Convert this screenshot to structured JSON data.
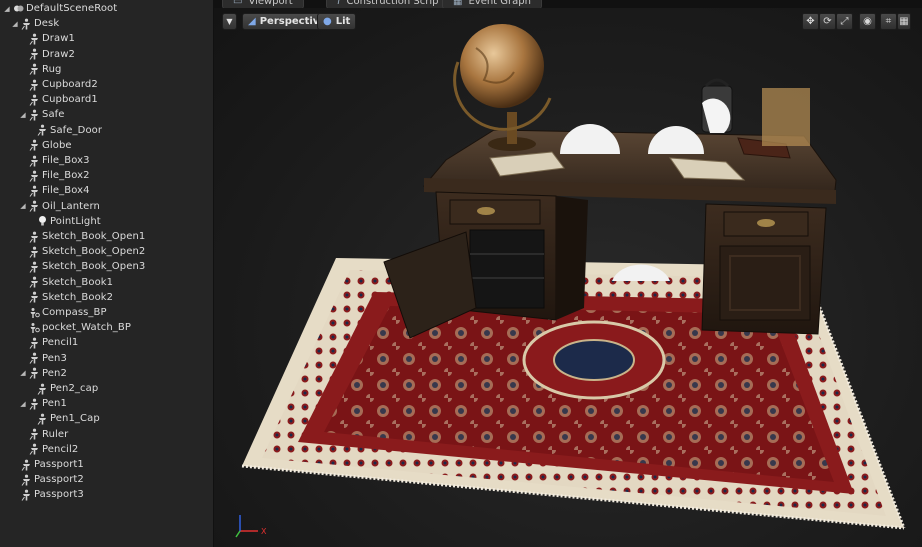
{
  "tabs": [
    {
      "label": "Viewport",
      "icon": "viewport-icon"
    },
    {
      "label": "Construction Scrip",
      "icon": "function-icon"
    },
    {
      "label": "Event Graph",
      "icon": "graph-icon"
    }
  ],
  "viewport": {
    "view_mode_label": "Perspective",
    "lighting_label": "Lit"
  },
  "outliner": {
    "items": [
      {
        "label": "DefaultSceneRoot",
        "indent": 0,
        "icon": "scene-root-icon",
        "expander": "expanded"
      },
      {
        "label": "Desk",
        "indent": 1,
        "icon": "static-mesh-icon",
        "expander": "expanded"
      },
      {
        "label": "Draw1",
        "indent": 2,
        "icon": "static-mesh-icon",
        "expander": "none"
      },
      {
        "label": "Draw2",
        "indent": 2,
        "icon": "static-mesh-icon",
        "expander": "none"
      },
      {
        "label": "Rug",
        "indent": 2,
        "icon": "static-mesh-icon",
        "expander": "none"
      },
      {
        "label": "Cupboard2",
        "indent": 2,
        "icon": "static-mesh-icon",
        "expander": "none"
      },
      {
        "label": "Cupboard1",
        "indent": 2,
        "icon": "static-mesh-icon",
        "expander": "none"
      },
      {
        "label": "Safe",
        "indent": 2,
        "icon": "static-mesh-icon",
        "expander": "expanded"
      },
      {
        "label": "Safe_Door",
        "indent": 3,
        "icon": "static-mesh-icon",
        "expander": "none"
      },
      {
        "label": "Globe",
        "indent": 2,
        "icon": "static-mesh-icon",
        "expander": "none"
      },
      {
        "label": "File_Box3",
        "indent": 2,
        "icon": "static-mesh-icon",
        "expander": "none"
      },
      {
        "label": "File_Box2",
        "indent": 2,
        "icon": "static-mesh-icon",
        "expander": "none"
      },
      {
        "label": "File_Box4",
        "indent": 2,
        "icon": "static-mesh-icon",
        "expander": "none"
      },
      {
        "label": "Oil_Lantern",
        "indent": 2,
        "icon": "static-mesh-icon",
        "expander": "expanded"
      },
      {
        "label": "PointLight",
        "indent": 3,
        "icon": "point-light-icon",
        "expander": "none"
      },
      {
        "label": "Sketch_Book_Open1",
        "indent": 2,
        "icon": "static-mesh-icon",
        "expander": "none"
      },
      {
        "label": "Sketch_Book_Open2",
        "indent": 2,
        "icon": "static-mesh-icon",
        "expander": "none"
      },
      {
        "label": "Sketch_Book_Open3",
        "indent": 2,
        "icon": "static-mesh-icon",
        "expander": "none"
      },
      {
        "label": "Sketch_Book1",
        "indent": 2,
        "icon": "static-mesh-icon",
        "expander": "none"
      },
      {
        "label": "Sketch_Book2",
        "indent": 2,
        "icon": "static-mesh-icon",
        "expander": "none"
      },
      {
        "label": "Compass_BP",
        "indent": 2,
        "icon": "child-actor-icon",
        "expander": "none"
      },
      {
        "label": "pocket_Watch_BP",
        "indent": 2,
        "icon": "child-actor-icon",
        "expander": "none"
      },
      {
        "label": "Pencil1",
        "indent": 2,
        "icon": "static-mesh-icon",
        "expander": "none"
      },
      {
        "label": "Pen3",
        "indent": 2,
        "icon": "static-mesh-icon",
        "expander": "none"
      },
      {
        "label": "Pen2",
        "indent": 2,
        "icon": "static-mesh-icon",
        "expander": "expanded"
      },
      {
        "label": "Pen2_cap",
        "indent": 3,
        "icon": "static-mesh-icon",
        "expander": "none"
      },
      {
        "label": "Pen1",
        "indent": 2,
        "icon": "static-mesh-icon",
        "expander": "expanded"
      },
      {
        "label": "Pen1_Cap",
        "indent": 3,
        "icon": "static-mesh-icon",
        "expander": "none"
      },
      {
        "label": "Ruler",
        "indent": 2,
        "icon": "static-mesh-icon",
        "expander": "none"
      },
      {
        "label": "Pencil2",
        "indent": 2,
        "icon": "static-mesh-icon",
        "expander": "none"
      },
      {
        "label": "Passport1",
        "indent": 1,
        "icon": "static-mesh-icon",
        "expander": "none"
      },
      {
        "label": "Passport2",
        "indent": 1,
        "icon": "static-mesh-icon",
        "expander": "none"
      },
      {
        "label": "Passport3",
        "indent": 1,
        "icon": "static-mesh-icon",
        "expander": "none"
      }
    ]
  },
  "toolbar_right": [
    {
      "icon": "translate-icon"
    },
    {
      "icon": "rotate-icon"
    },
    {
      "icon": "scale-icon"
    },
    {
      "icon": "world-space-icon"
    },
    {
      "icon": "surface-snap-icon"
    },
    {
      "icon": "grid-snap-icon"
    }
  ],
  "axis_gizmo": {
    "x_label": "X",
    "y_label": "",
    "z_label": ""
  },
  "colors": {
    "panel_bg": "#252525",
    "viewport_bg": "#1d1d1d",
    "text": "#dcdcdc",
    "axis_x": "#e03030",
    "axis_y": "#40c040",
    "axis_z": "#3060e0"
  }
}
